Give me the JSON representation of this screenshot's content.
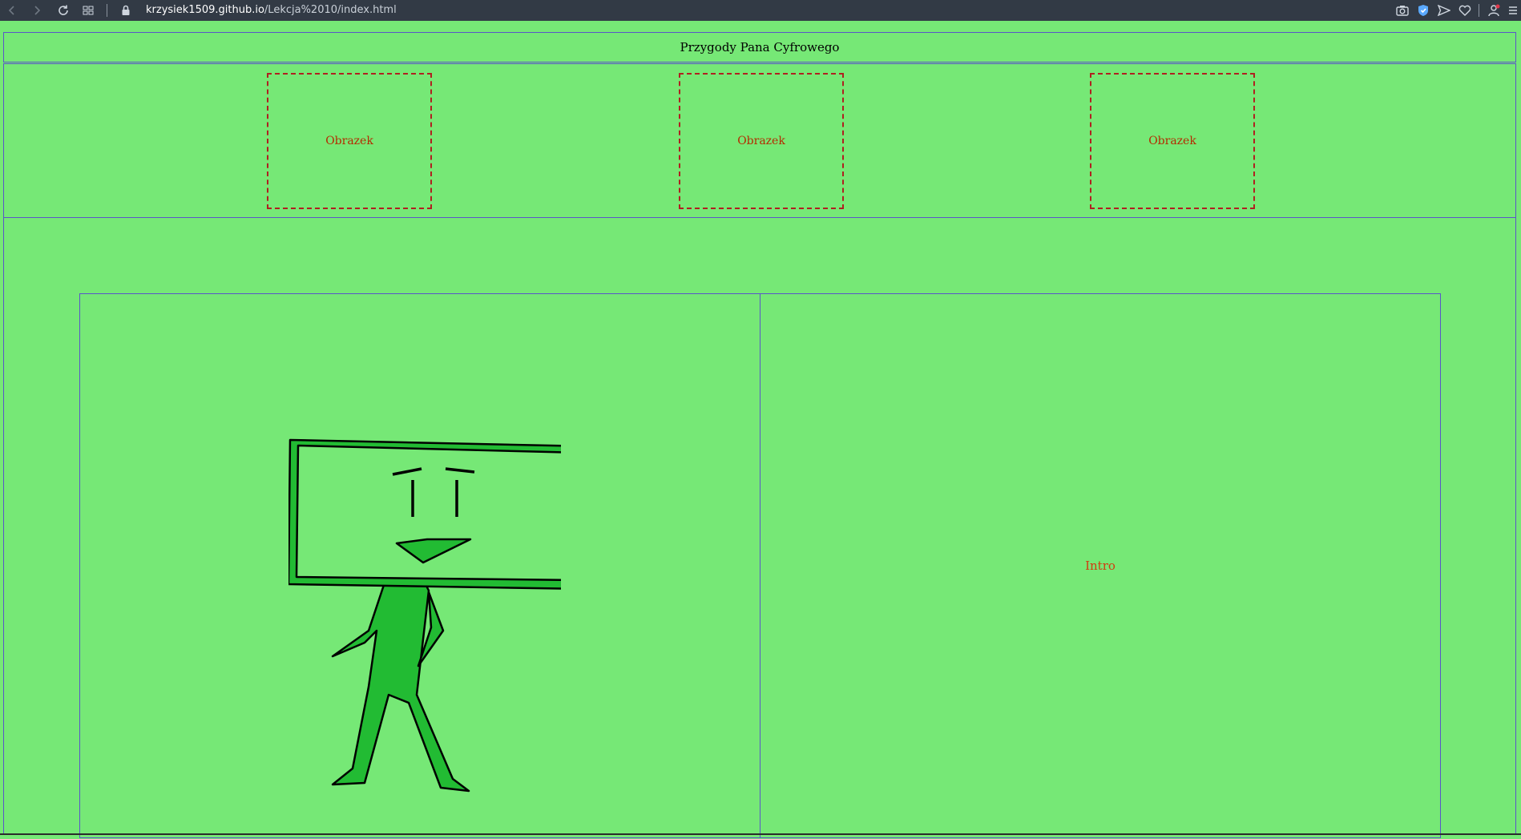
{
  "browser": {
    "url_host": "krzysiek1509.github.io",
    "url_path": "/Lekcja%2010/index.html",
    "icons": [
      "back-icon",
      "forward-icon",
      "reload-icon",
      "tabs-grid-icon",
      "lock-icon",
      "camera-icon",
      "shield-icon",
      "send-icon",
      "heart-icon",
      "profile-icon",
      "menu-icon"
    ]
  },
  "header": {
    "title": "Przygody Pana Cyfrowego"
  },
  "gallery": {
    "items": [
      {
        "label": "Obrazek"
      },
      {
        "label": "Obrazek"
      },
      {
        "label": "Obrazek"
      }
    ]
  },
  "main": {
    "right_label": "Intro"
  },
  "colors": {
    "page_bg": "#76e876",
    "border": "#5a56c8",
    "dashed_border": "#b02020",
    "label_red": "#b52a00",
    "character_green": "#22bb33"
  }
}
